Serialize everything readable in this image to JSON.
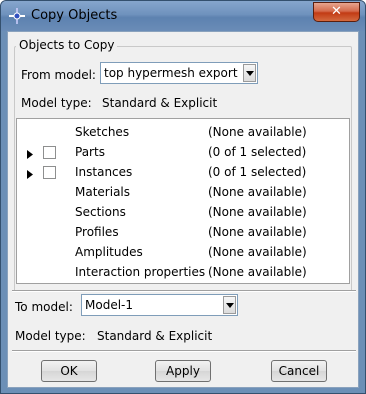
{
  "window": {
    "title": "Copy Objects",
    "close_label": "✕"
  },
  "group": {
    "legend": "Objects to Copy",
    "from_model_label": "From model:",
    "from_model_value": "top hypermesh export",
    "model_type_label": "Model type:",
    "model_type_value": "Standard & Explicit"
  },
  "tree": {
    "rows": [
      {
        "name": "Sketches",
        "status": "(None available)",
        "expandable": false,
        "checkbox": false
      },
      {
        "name": "Parts",
        "status": "(0 of 1 selected)",
        "expandable": true,
        "checkbox": true
      },
      {
        "name": "Instances",
        "status": "(0 of 1 selected)",
        "expandable": true,
        "checkbox": true
      },
      {
        "name": "Materials",
        "status": "(None available)",
        "expandable": false,
        "checkbox": false
      },
      {
        "name": "Sections",
        "status": "(None available)",
        "expandable": false,
        "checkbox": false
      },
      {
        "name": "Profiles",
        "status": "(None available)",
        "expandable": false,
        "checkbox": false
      },
      {
        "name": "Amplitudes",
        "status": "(None available)",
        "expandable": false,
        "checkbox": false
      },
      {
        "name": "Interaction properties",
        "status": "(None available)",
        "expandable": false,
        "checkbox": false
      }
    ]
  },
  "target": {
    "to_model_label": "To model:",
    "to_model_value": "Model-1",
    "model_type_label": "Model type:",
    "model_type_value": "Standard & Explicit"
  },
  "buttons": {
    "ok": "OK",
    "apply": "Apply",
    "cancel": "Cancel"
  }
}
